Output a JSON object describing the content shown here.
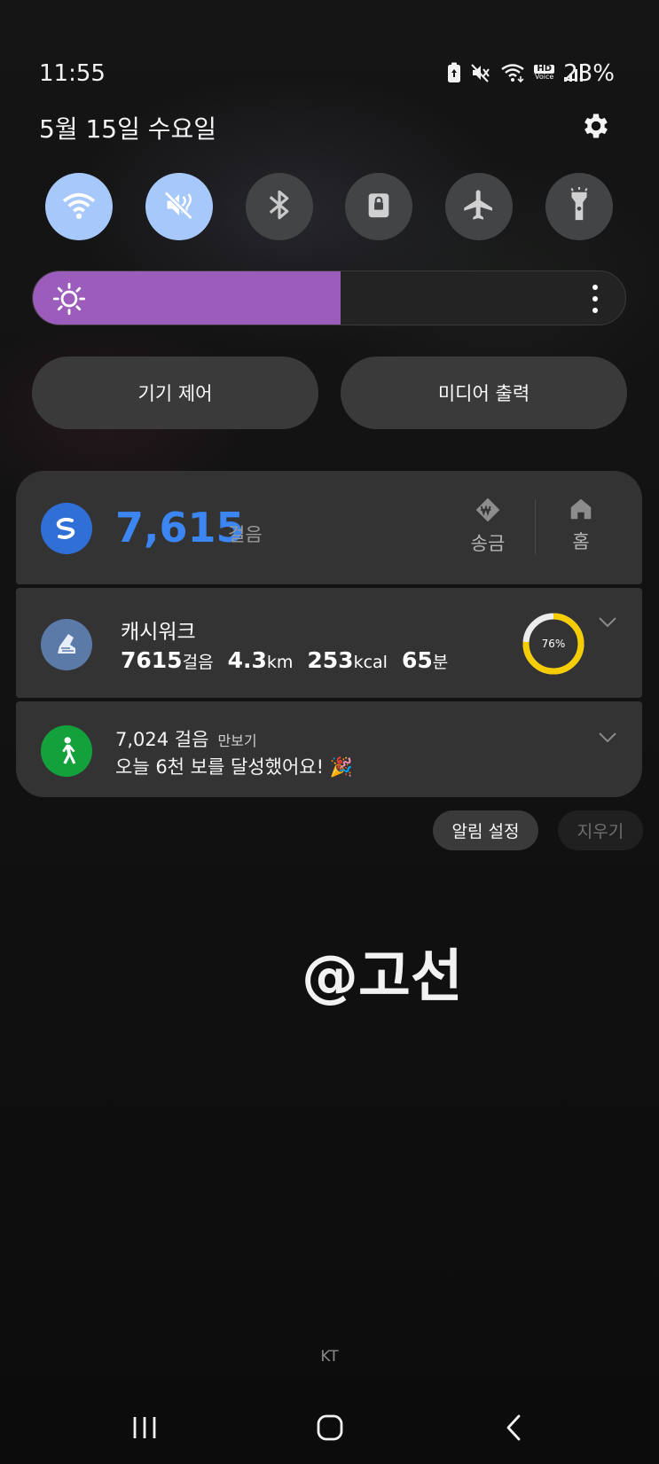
{
  "status_bar": {
    "time": "11:55",
    "battery_percent": "23%",
    "icons": [
      "battery-saver-icon",
      "mute-icon",
      "wifi-icon",
      "hd-voice-icon",
      "signal-icon"
    ],
    "hd_label": "HD",
    "voice_label": "Voice"
  },
  "header": {
    "date": "5월 15일 수요일",
    "settings_icon": "gear-icon"
  },
  "quick_settings": {
    "tiles": [
      {
        "name": "wifi",
        "icon": "wifi-icon",
        "active": true
      },
      {
        "name": "sound",
        "icon": "mute-icon",
        "active": true
      },
      {
        "name": "bluetooth",
        "icon": "bluetooth-icon",
        "active": false
      },
      {
        "name": "rotation-lock",
        "icon": "lock-icon",
        "active": false
      },
      {
        "name": "airplane",
        "icon": "airplane-icon",
        "active": false
      },
      {
        "name": "flashlight",
        "icon": "flashlight-icon",
        "active": false
      }
    ],
    "brightness_level": 0.52,
    "brightness_color": "#9b5cbb",
    "device_control_label": "기기 제어",
    "media_output_label": "미디어 출력"
  },
  "notifications": {
    "pay": {
      "steps": "7,615",
      "steps_unit": "걸음",
      "send_label": "송금",
      "home_label": "홈",
      "accent": "#3b86f3"
    },
    "cashwalk": {
      "title": "캐시워크",
      "steps": "7615",
      "steps_unit": "걸음",
      "distance": "4.3",
      "distance_unit": "km",
      "calories": "253",
      "calories_unit": "kcal",
      "minutes": "65",
      "minutes_unit": "분",
      "progress_label": "76%",
      "progress": 0.76,
      "ring_color": "#f5cd00"
    },
    "manbogi": {
      "steps": "7,024 걸음",
      "app_name": "만보기",
      "message": "오늘 6천 보를 달성했어요! 🎉"
    },
    "settings_label": "알림 설정",
    "clear_label": "지우기"
  },
  "watermark": "@고선",
  "carrier": "KT",
  "navigation": {
    "recents_icon": "recents-icon",
    "home_icon": "home-icon",
    "back_icon": "back-icon"
  }
}
